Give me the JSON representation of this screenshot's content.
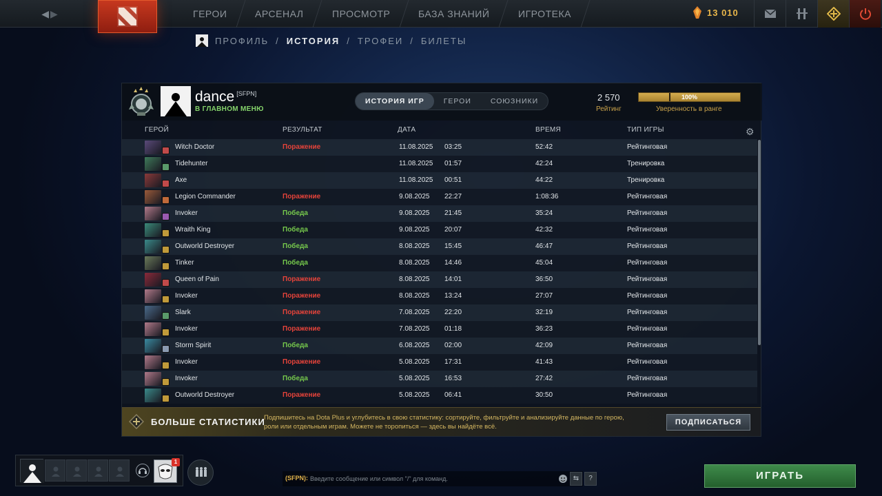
{
  "topbar": {
    "nav": [
      "ГЕРОИ",
      "АРСЕНАЛ",
      "ПРОСМОТР",
      "БАЗА ЗНАНИЙ",
      "ИГРОТЕКА"
    ],
    "shards": "13 010"
  },
  "subnav": {
    "profile": "ПРОФИЛЬ",
    "history": "ИСТОРИЯ",
    "trophies": "ТРОФЕИ",
    "tickets": "БИЛЕТЫ",
    "sep": "/"
  },
  "profile": {
    "name": "dance",
    "tag": "[SFPN]",
    "status": "В ГЛАВНОМ МЕНЮ",
    "rating": "2 570",
    "rating_label": "Рейтинг",
    "confidence": "100%",
    "confidence_fraction": 1.0,
    "confidence_label": "Уверенность в ранге"
  },
  "tabs": {
    "history": "ИСТОРИЯ ИГР",
    "heroes": "ГЕРОИ",
    "allies": "СОЮЗНИКИ"
  },
  "table": {
    "headers": {
      "hero": "ГЕРОЙ",
      "result": "РЕЗУЛЬТАТ",
      "date": "ДАТА",
      "duration": "ВРЕМЯ",
      "type": "ТИП ИГРЫ"
    },
    "rows": [
      {
        "hero": "Witch Doctor",
        "result": "Поражение",
        "win": false,
        "date": "11.08.2025",
        "time": "03:25",
        "duration": "52:42",
        "type": "Рейтинговая",
        "color": "#5a4a7a",
        "role": "#c04a4a"
      },
      {
        "hero": "Tidehunter",
        "result": "",
        "win": null,
        "date": "11.08.2025",
        "time": "01:57",
        "duration": "42:24",
        "type": "Тренировка",
        "color": "#3f7a5a",
        "role": "#5a9a6a"
      },
      {
        "hero": "Axe",
        "result": "",
        "win": null,
        "date": "11.08.2025",
        "time": "00:51",
        "duration": "44:22",
        "type": "Тренировка",
        "color": "#8a3a3a",
        "role": "#c04a4a"
      },
      {
        "hero": "Legion Commander",
        "result": "Поражение",
        "win": false,
        "date": "9.08.2025",
        "time": "22:27",
        "duration": "1:08:36",
        "type": "Рейтинговая",
        "color": "#9a5a3a",
        "role": "#c06a3a"
      },
      {
        "hero": "Invoker",
        "result": "Победа",
        "win": true,
        "date": "9.08.2025",
        "time": "21:45",
        "duration": "35:24",
        "type": "Рейтинговая",
        "color": "#b07a8a",
        "role": "#9a5ab0"
      },
      {
        "hero": "Wraith King",
        "result": "Победа",
        "win": true,
        "date": "9.08.2025",
        "time": "20:07",
        "duration": "42:32",
        "type": "Рейтинговая",
        "color": "#3a8a7a",
        "role": "#c09a3a"
      },
      {
        "hero": "Outworld Destroyer",
        "result": "Победа",
        "win": true,
        "date": "8.08.2025",
        "time": "15:45",
        "duration": "46:47",
        "type": "Рейтинговая",
        "color": "#3a8a8a",
        "role": "#c09a3a"
      },
      {
        "hero": "Tinker",
        "result": "Победа",
        "win": true,
        "date": "8.08.2025",
        "time": "14:46",
        "duration": "45:04",
        "type": "Рейтинговая",
        "color": "#6a7a5a",
        "role": "#c09a3a"
      },
      {
        "hero": "Queen of Pain",
        "result": "Поражение",
        "win": false,
        "date": "8.08.2025",
        "time": "14:01",
        "duration": "36:50",
        "type": "Рейтинговая",
        "color": "#8a2a3a",
        "role": "#c04a4a"
      },
      {
        "hero": "Invoker",
        "result": "Поражение",
        "win": false,
        "date": "8.08.2025",
        "time": "13:24",
        "duration": "27:07",
        "type": "Рейтинговая",
        "color": "#b07a8a",
        "role": "#c09a3a"
      },
      {
        "hero": "Slark",
        "result": "Поражение",
        "win": false,
        "date": "7.08.2025",
        "time": "22:20",
        "duration": "32:19",
        "type": "Рейтинговая",
        "color": "#4a6a8a",
        "role": "#5a9a6a"
      },
      {
        "hero": "Invoker",
        "result": "Поражение",
        "win": false,
        "date": "7.08.2025",
        "time": "01:18",
        "duration": "36:23",
        "type": "Рейтинговая",
        "color": "#b07a8a",
        "role": "#c09a3a"
      },
      {
        "hero": "Storm Spirit",
        "result": "Победа",
        "win": true,
        "date": "6.08.2025",
        "time": "02:00",
        "duration": "42:09",
        "type": "Рейтинговая",
        "color": "#3a8aa0",
        "role": "#8a9ab0"
      },
      {
        "hero": "Invoker",
        "result": "Поражение",
        "win": false,
        "date": "5.08.2025",
        "time": "17:31",
        "duration": "41:43",
        "type": "Рейтинговая",
        "color": "#b07a8a",
        "role": "#c09a3a"
      },
      {
        "hero": "Invoker",
        "result": "Победа",
        "win": true,
        "date": "5.08.2025",
        "time": "16:53",
        "duration": "27:42",
        "type": "Рейтинговая",
        "color": "#b07a8a",
        "role": "#c09a3a"
      },
      {
        "hero": "Outworld Destroyer",
        "result": "Поражение",
        "win": false,
        "date": "5.08.2025",
        "time": "06:41",
        "duration": "30:50",
        "type": "Рейтинговая",
        "color": "#3a8a8a",
        "role": "#c09a3a"
      }
    ]
  },
  "plus": {
    "title": "БОЛЬШЕ СТАТИСТИКИ",
    "desc": "Подпишитесь на Dota Plus и углубитесь в свою статистику: сортируйте, фильтруйте и анализируйте данные по герою, роли или отдельным играм. Можете не торопиться — здесь вы найдёте всё.",
    "button": "ПОДПИСАТЬСЯ"
  },
  "party": {
    "badge": "1"
  },
  "chat": {
    "channel": "(SFPN):",
    "placeholder": "Введите сообщение или символ \"/\" для команд.",
    "help": "?"
  },
  "play": "ИГРАТЬ",
  "colors": {
    "win": "#76c94c",
    "loss": "#e5433a",
    "gold": "#c9a24a",
    "play": "#2f7a3b"
  }
}
